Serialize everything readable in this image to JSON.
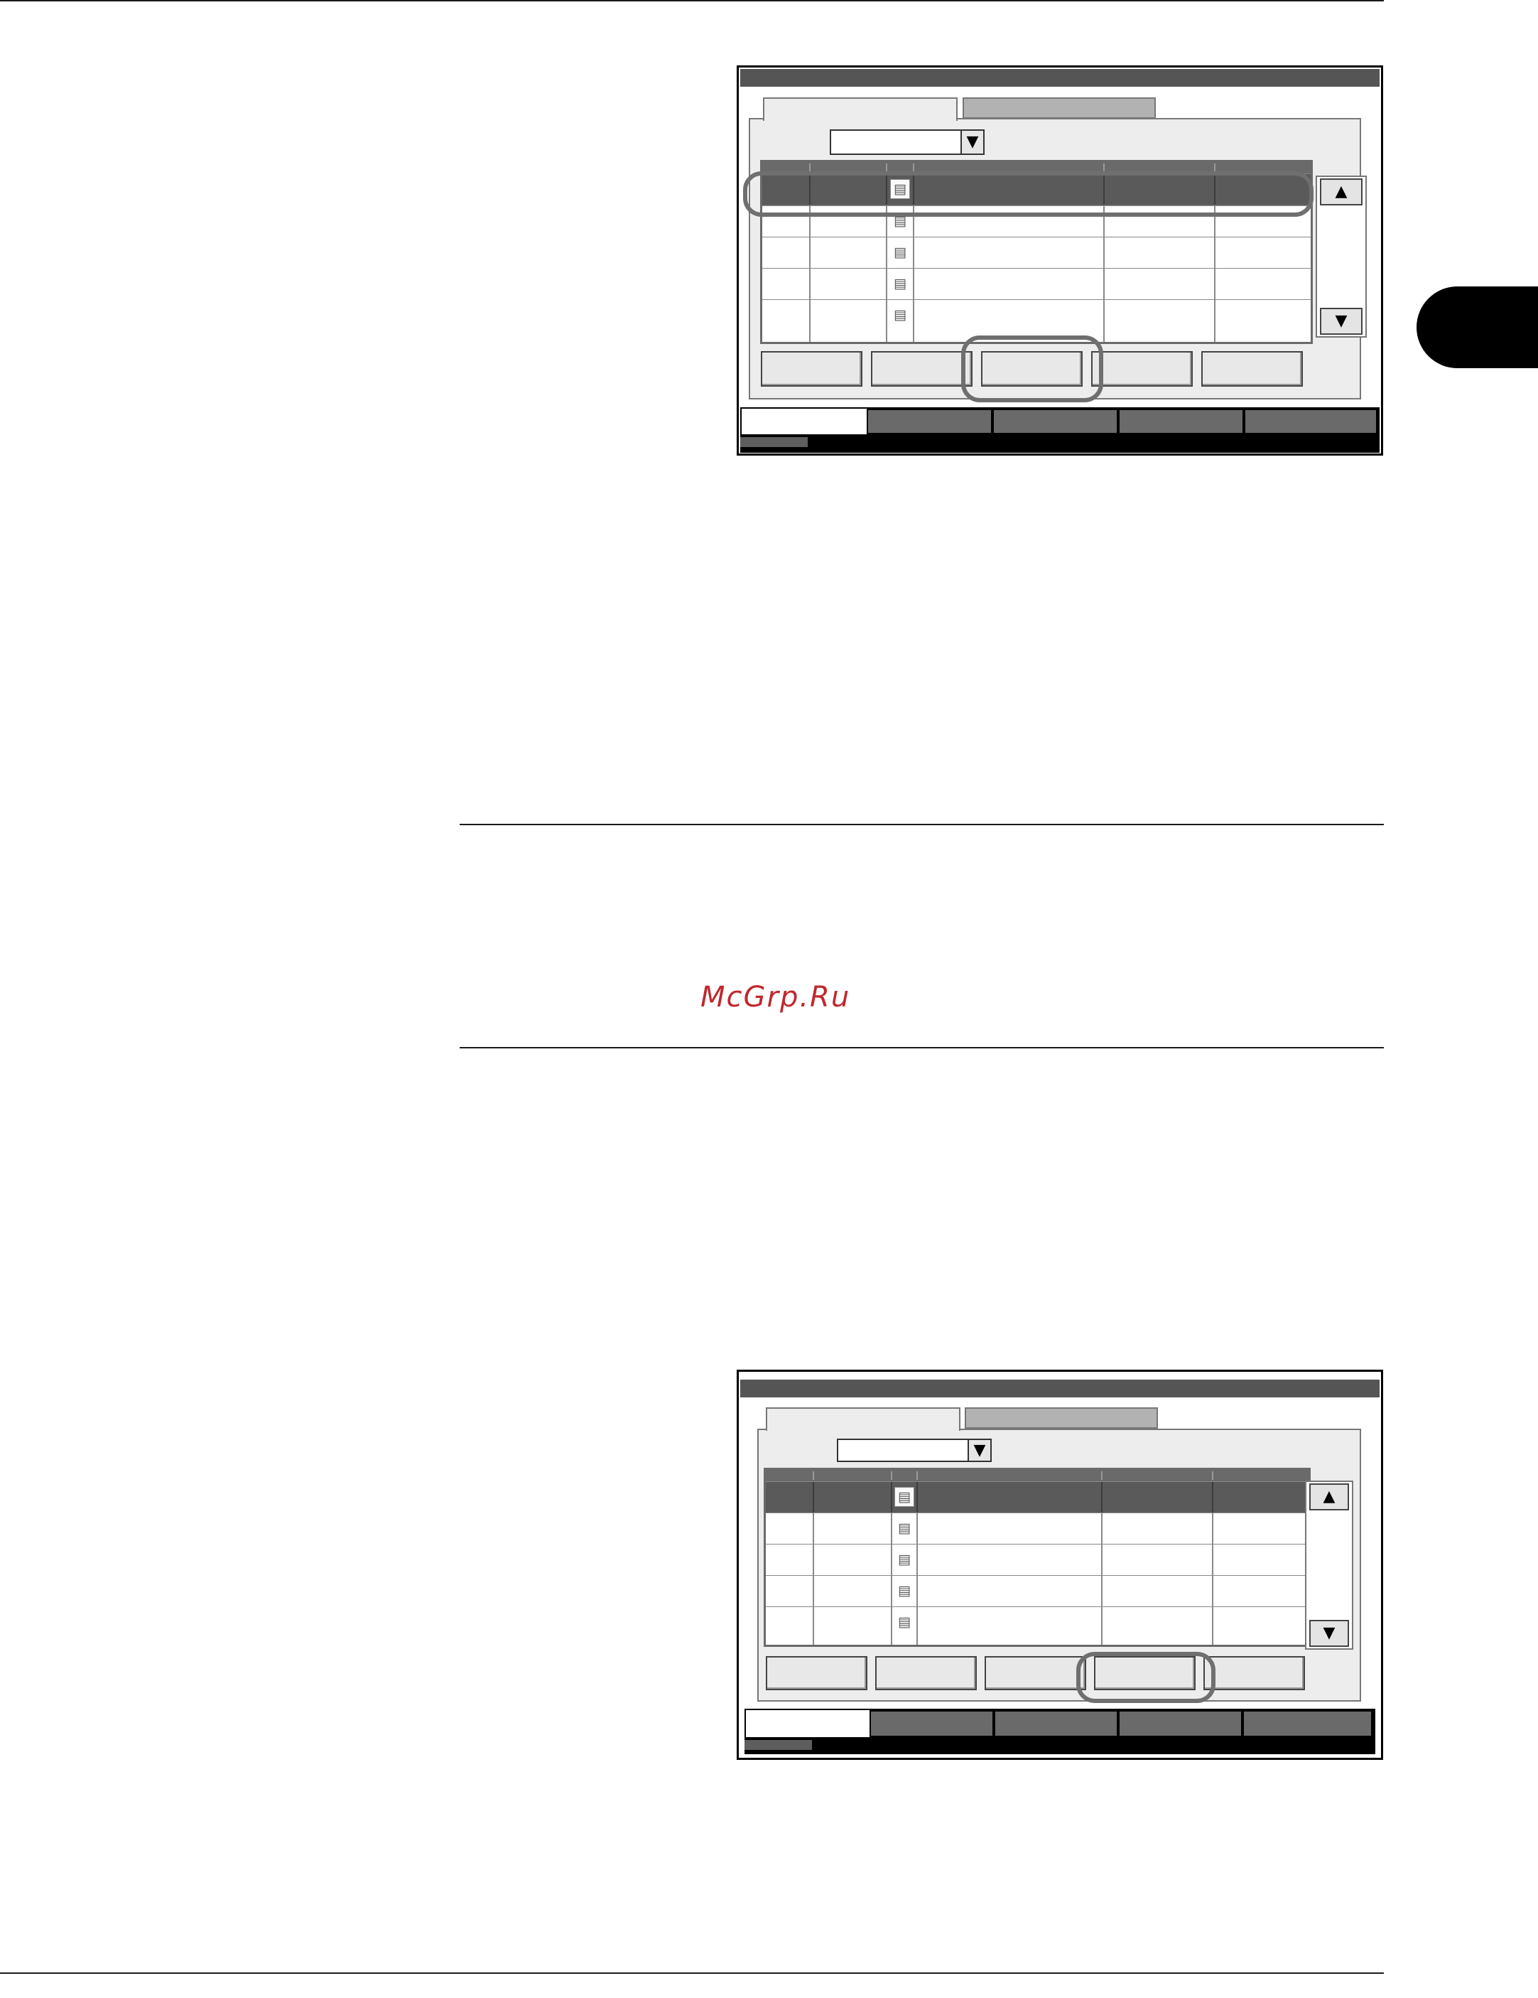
{
  "page": {
    "watermark": "McGrp.Ru"
  },
  "panels": [
    {
      "name": "screen-1",
      "dropdown_value": "",
      "rows": 5,
      "selected_row": 1,
      "highlighted_button": 3,
      "highlighted_row": 1,
      "active_bottom_tab": 1
    },
    {
      "name": "screen-2",
      "dropdown_value": "",
      "rows": 5,
      "selected_row": 1,
      "highlighted_button": 4,
      "active_bottom_tab": 1
    }
  ],
  "icons": {
    "scroll_up": "▲",
    "scroll_down": "▼",
    "dropdown": "▼",
    "document": "document-stack-icon"
  },
  "glyphs": {
    "up": "▲",
    "down": "▼",
    "doc": "▤"
  }
}
